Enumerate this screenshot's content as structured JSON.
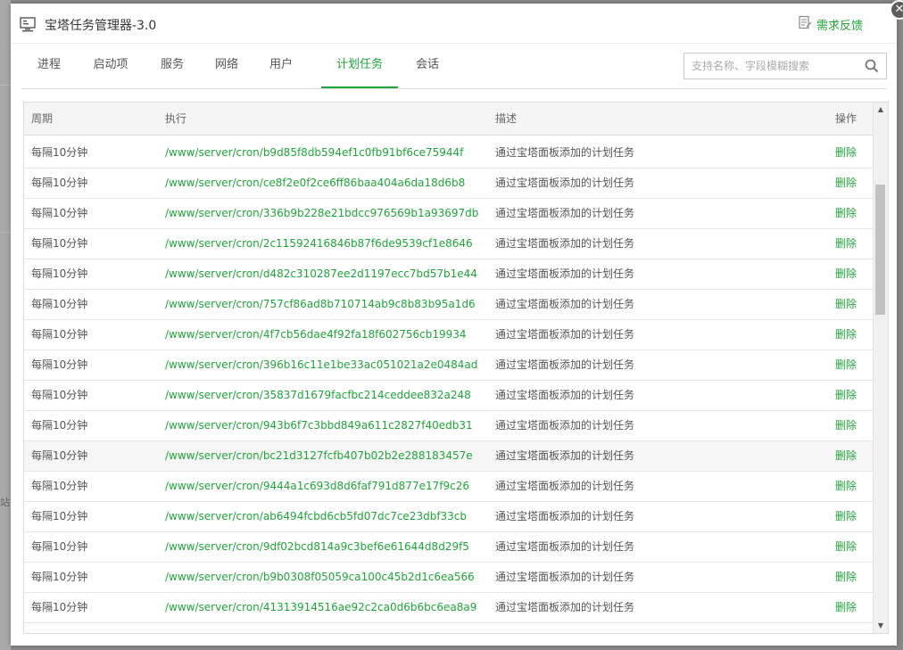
{
  "background": {
    "partial_text": "站"
  },
  "window": {
    "title": "宝塔任务管理器-3.0",
    "feedback_label": "需求反馈",
    "close_symbol": "✕"
  },
  "tabs": [
    {
      "label": "进程"
    },
    {
      "label": "启动项"
    },
    {
      "label": "服务"
    },
    {
      "label": "网络"
    },
    {
      "label": "用户"
    },
    {
      "label": "计划任务",
      "active": true
    },
    {
      "label": "会话"
    }
  ],
  "search": {
    "placeholder": "支持名称、字段模糊搜索",
    "value": ""
  },
  "table": {
    "headers": {
      "cycle": "周期",
      "exec": "执行",
      "desc": "描述",
      "op": "操作"
    },
    "rows": [
      {
        "cycle": "每隔10分钟",
        "exec": "/www/server/cron/b9d85f8db594ef1c0fb91bf6ce75944f",
        "desc": "通过宝塔面板添加的计划任务",
        "op": "删除"
      },
      {
        "cycle": "每隔10分钟",
        "exec": "/www/server/cron/ce8f2e0f2ce6ff86baa404a6da18d6b8",
        "desc": "通过宝塔面板添加的计划任务",
        "op": "删除"
      },
      {
        "cycle": "每隔10分钟",
        "exec": "/www/server/cron/336b9b228e21bdcc976569b1a93697db",
        "desc": "通过宝塔面板添加的计划任务",
        "op": "删除"
      },
      {
        "cycle": "每隔10分钟",
        "exec": "/www/server/cron/2c11592416846b87f6de9539cf1e8646",
        "desc": "通过宝塔面板添加的计划任务",
        "op": "删除"
      },
      {
        "cycle": "每隔10分钟",
        "exec": "/www/server/cron/d482c310287ee2d1197ecc7bd57b1e44",
        "desc": "通过宝塔面板添加的计划任务",
        "op": "删除"
      },
      {
        "cycle": "每隔10分钟",
        "exec": "/www/server/cron/757cf86ad8b710714ab9c8b83b95a1d6",
        "desc": "通过宝塔面板添加的计划任务",
        "op": "删除"
      },
      {
        "cycle": "每隔10分钟",
        "exec": "/www/server/cron/4f7cb56dae4f92fa18f602756cb19934",
        "desc": "通过宝塔面板添加的计划任务",
        "op": "删除"
      },
      {
        "cycle": "每隔10分钟",
        "exec": "/www/server/cron/396b16c11e1be33ac051021a2e0484ad",
        "desc": "通过宝塔面板添加的计划任务",
        "op": "删除"
      },
      {
        "cycle": "每隔10分钟",
        "exec": "/www/server/cron/35837d1679facfbc214ceddee832a248",
        "desc": "通过宝塔面板添加的计划任务",
        "op": "删除"
      },
      {
        "cycle": "每隔10分钟",
        "exec": "/www/server/cron/943b6f7c3bbd849a611c2827f40edb31",
        "desc": "通过宝塔面板添加的计划任务",
        "op": "删除"
      },
      {
        "cycle": "每隔10分钟",
        "exec": "/www/server/cron/bc21d3127fcfb407b02b2e288183457e",
        "desc": "通过宝塔面板添加的计划任务",
        "op": "删除",
        "highlight": true
      },
      {
        "cycle": "每隔10分钟",
        "exec": "/www/server/cron/9444a1c693d8d6faf791d877e17f9c26",
        "desc": "通过宝塔面板添加的计划任务",
        "op": "删除"
      },
      {
        "cycle": "每隔10分钟",
        "exec": "/www/server/cron/ab6494fcbd6cb5fd07dc7ce23dbf33cb",
        "desc": "通过宝塔面板添加的计划任务",
        "op": "删除"
      },
      {
        "cycle": "每隔10分钟",
        "exec": "/www/server/cron/9df02bcd814a9c3bef6e61644d8d29f5",
        "desc": "通过宝塔面板添加的计划任务",
        "op": "删除"
      },
      {
        "cycle": "每隔10分钟",
        "exec": "/www/server/cron/b9b0308f05059ca100c45b2d1c6ea566",
        "desc": "通过宝塔面板添加的计划任务",
        "op": "删除"
      },
      {
        "cycle": "每隔10分钟",
        "exec": "/www/server/cron/41313914516ae92c2ca0d6b6bc6ea8a9",
        "desc": "通过宝塔面板添加的计划任务",
        "op": "删除"
      }
    ]
  },
  "colors": {
    "accent": "#20a53a",
    "text": "#555555",
    "header_bg": "#f5f5f5",
    "overlay": "#8a8a8a"
  },
  "icons": {
    "app": "monitor-icon",
    "feedback": "document-edit-icon",
    "search": "search-icon",
    "close": "close-icon"
  }
}
